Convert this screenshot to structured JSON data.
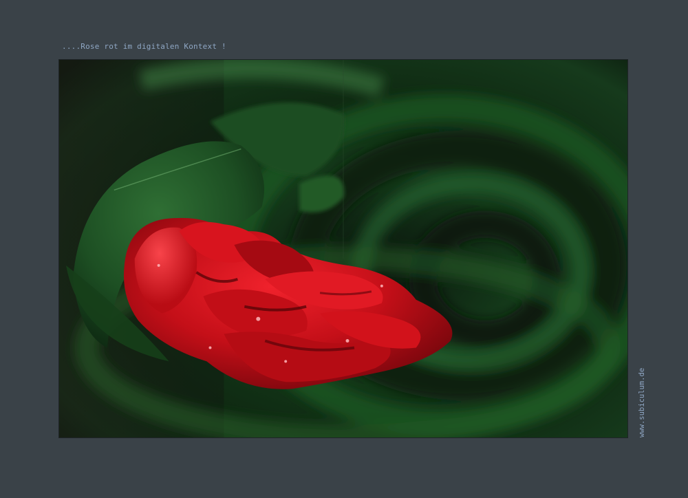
{
  "caption": "....Rose rot im digitalen Kontext !",
  "watermark": "www.subiculum.de",
  "colors": {
    "background": "#3a4248",
    "caption_text": "#8fa7c4",
    "rose_red": "#d0101a",
    "leaf_green": "#1f5a26"
  }
}
